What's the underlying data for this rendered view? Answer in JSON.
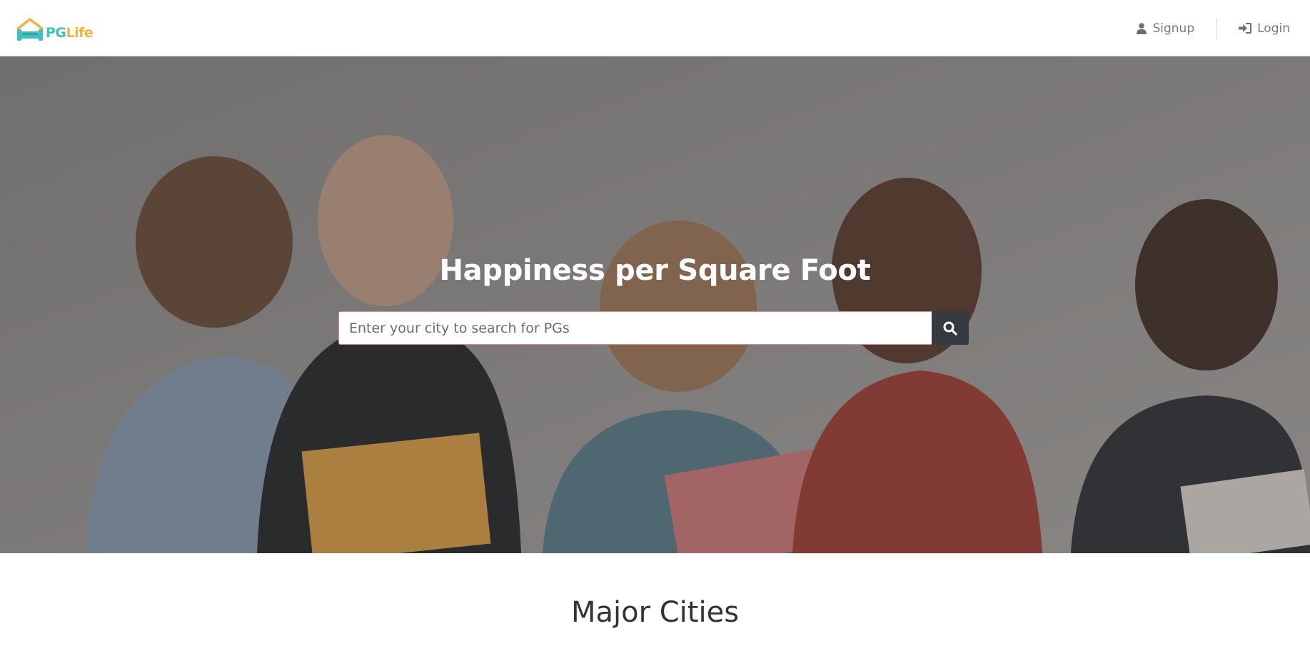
{
  "brand": {
    "part1": "PG",
    "part2": "Life"
  },
  "nav": {
    "signup": {
      "label": "Signup",
      "icon": "user-icon"
    },
    "login": {
      "label": "Login",
      "icon": "sign-in-icon"
    }
  },
  "hero": {
    "title": "Happiness per Square Foot",
    "search": {
      "placeholder": "Enter your city to search for PGs",
      "value": "",
      "button_icon": "search-icon"
    }
  },
  "section": {
    "title": "Major Cities"
  },
  "colors": {
    "brand_teal": "#3fbfbf",
    "brand_yellow": "#f2b33d",
    "search_button": "#343a40"
  }
}
